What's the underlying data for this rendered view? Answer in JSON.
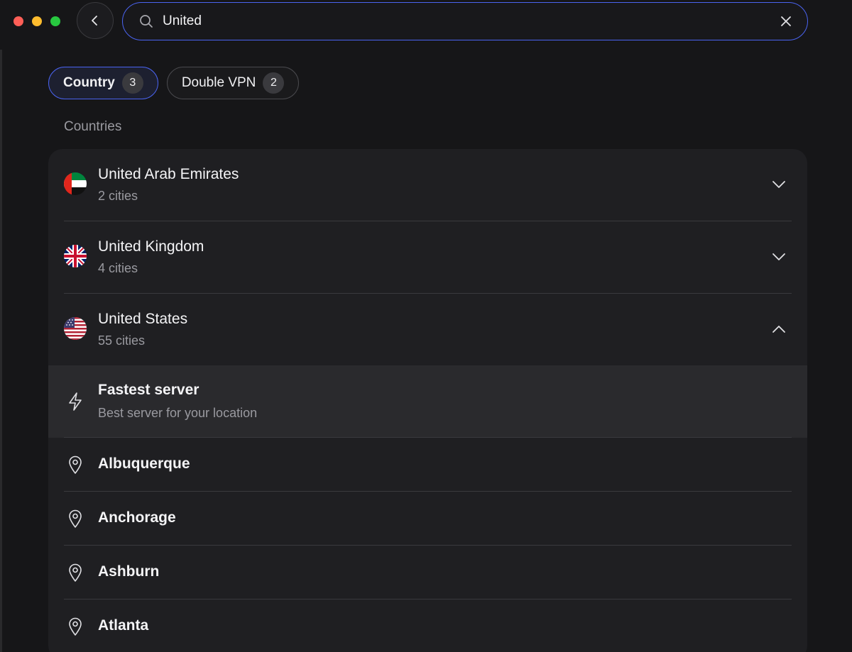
{
  "search": {
    "value": "United",
    "placeholder": "Search"
  },
  "filters": [
    {
      "label": "Country",
      "count": "3",
      "active": true
    },
    {
      "label": "Double VPN",
      "count": "2",
      "active": false
    }
  ],
  "section_label": "Countries",
  "countries": [
    {
      "name": "United Arab Emirates",
      "subtitle": "2 cities",
      "flag": "uae-flag-icon",
      "expanded": false
    },
    {
      "name": "United Kingdom",
      "subtitle": "4 cities",
      "flag": "uk-flag-icon",
      "expanded": false
    },
    {
      "name": "United States",
      "subtitle": "55 cities",
      "flag": "us-flag-icon",
      "expanded": true
    }
  ],
  "fastest_server": {
    "title": "Fastest server",
    "subtitle": "Best server for your location",
    "icon": "lightning-icon"
  },
  "cities": [
    {
      "name": "Albuquerque",
      "icon": "location-pin-icon"
    },
    {
      "name": "Anchorage",
      "icon": "location-pin-icon"
    },
    {
      "name": "Ashburn",
      "icon": "location-pin-icon"
    },
    {
      "name": "Atlanta",
      "icon": "location-pin-icon"
    }
  ],
  "colors": {
    "accent": "#4a63f0",
    "background": "#161618",
    "card": "#1f1f22",
    "highlight_row": "#2a2a2d",
    "muted_text": "#9a9aa0"
  }
}
